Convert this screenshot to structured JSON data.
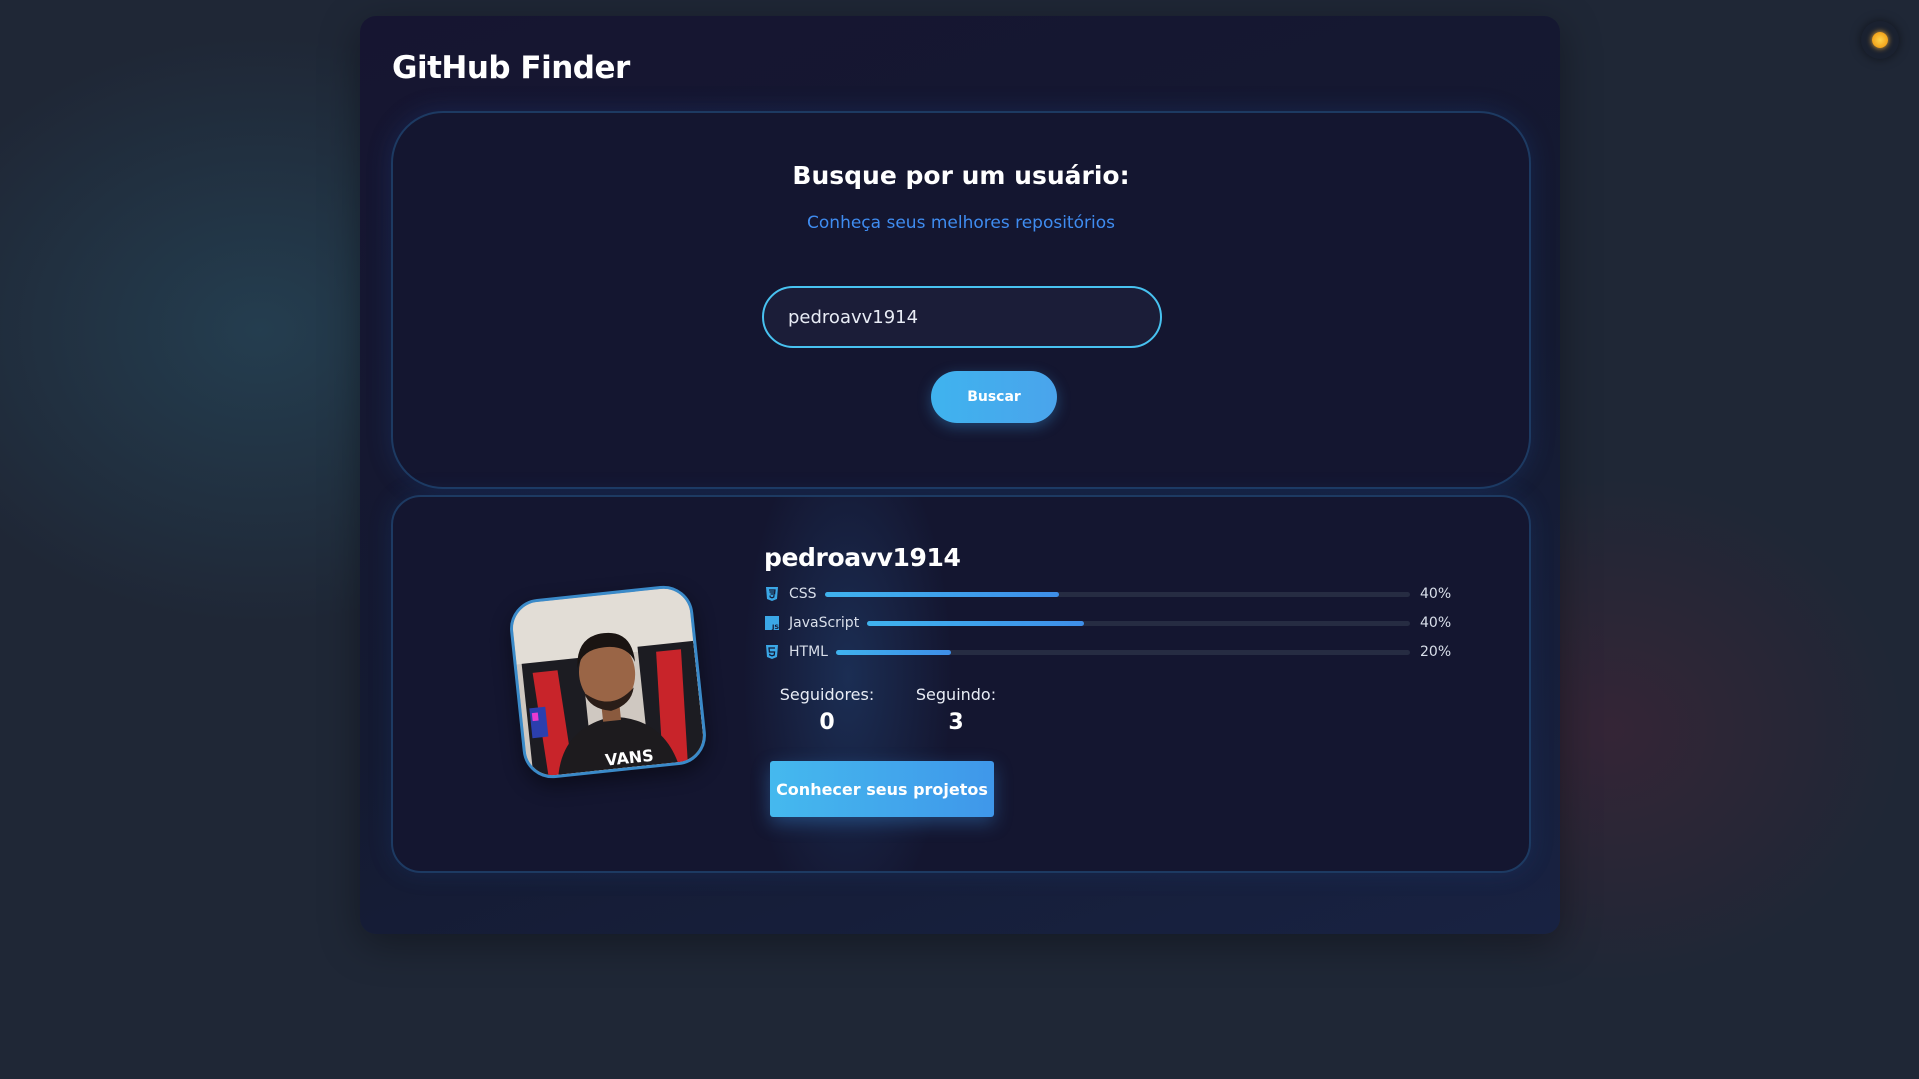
{
  "header": {
    "title": "GitHub Finder"
  },
  "theme_toggle": {
    "icon": "sun-icon"
  },
  "search": {
    "heading": "Busque por um usuário:",
    "subtitle": "Conheça seus melhores repositórios",
    "input_value": "pedroavv1914",
    "button_label": "Buscar"
  },
  "profile": {
    "username": "pedroavv1914",
    "languages": [
      {
        "name": "CSS",
        "percent_label": "40%",
        "fill": 0.4,
        "icon": "css-icon"
      },
      {
        "name": "JavaScript",
        "percent_label": "40%",
        "fill": 0.4,
        "icon": "javascript-icon"
      },
      {
        "name": "HTML",
        "percent_label": "20%",
        "fill": 0.2,
        "icon": "html-icon"
      }
    ],
    "followers_label": "Seguidores:",
    "followers_value": "0",
    "following_label": "Seguindo:",
    "following_value": "3",
    "projects_button_label": "Conhecer seus projetos"
  },
  "colors": {
    "accent": "#3fb3ee",
    "link": "#3f8cf0",
    "background": "#1f2736",
    "card": "#141630"
  }
}
